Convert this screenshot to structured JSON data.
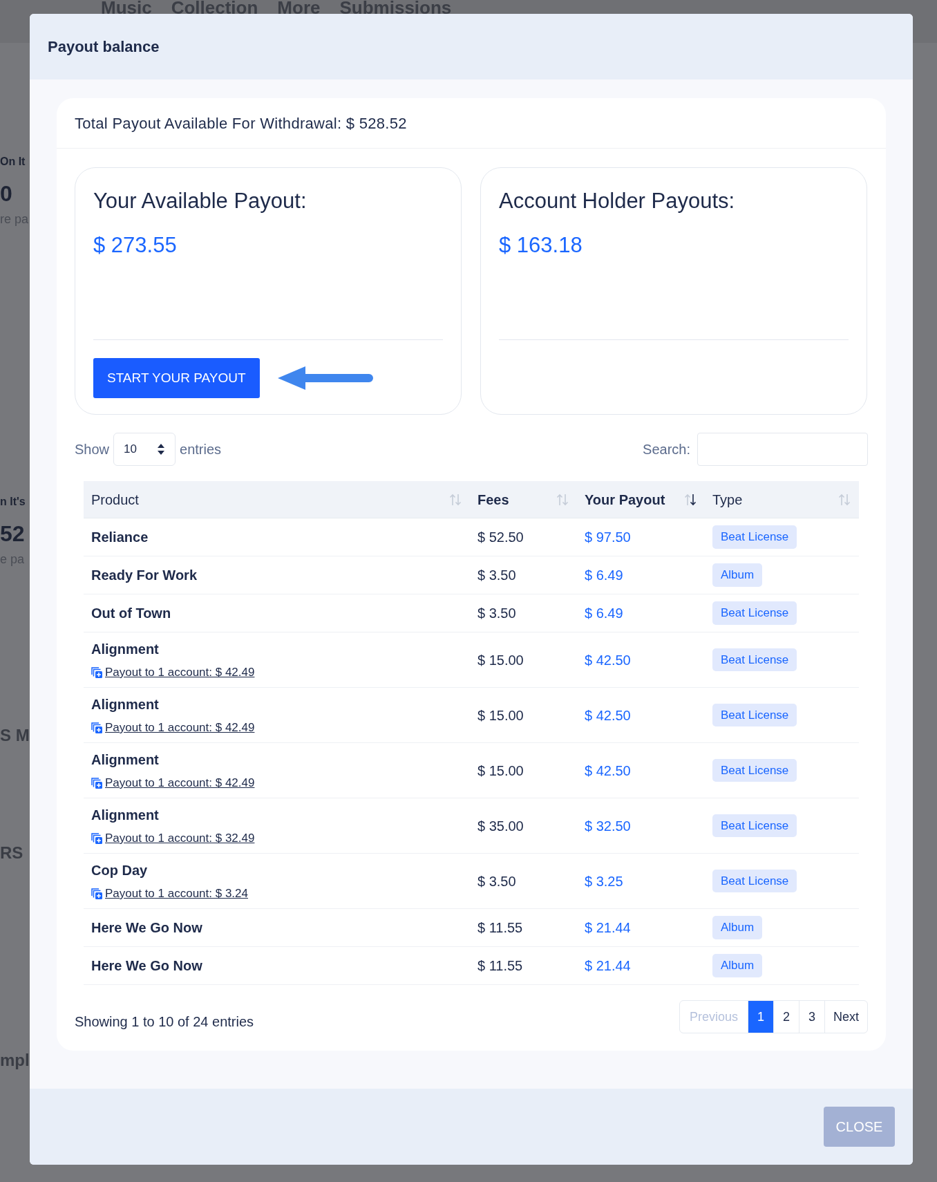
{
  "background": {
    "nav": [
      "Music",
      "Collection",
      "More",
      "Submissions"
    ],
    "fragments": [
      {
        "kind": "label",
        "text": "On It"
      },
      {
        "kind": "value",
        "text": "0"
      },
      {
        "kind": "note",
        "text": "re pa"
      },
      {
        "kind": "label",
        "text": "n It's"
      },
      {
        "kind": "value",
        "text": "52"
      },
      {
        "kind": "note",
        "text": "e pa"
      },
      {
        "kind": "heading",
        "text": "S M"
      },
      {
        "kind": "heading",
        "text": "RS"
      },
      {
        "kind": "heading",
        "text": "mpl"
      }
    ]
  },
  "modal": {
    "title": "Payout balance",
    "total": "Total Payout Available For Withdrawal: $ 528.52",
    "panels": [
      {
        "title": "Your Available Payout:",
        "amount": "$ 273.55",
        "button": "START YOUR PAYOUT"
      },
      {
        "title": "Account Holder Payouts:",
        "amount": "$ 163.18"
      }
    ],
    "length": {
      "before": "Show",
      "value": "10",
      "after": "entries"
    },
    "search": {
      "label": "Search:"
    },
    "table": {
      "columns": [
        {
          "label": "Product",
          "sorted_desc": false
        },
        {
          "label": "Fees",
          "sorted_desc": false
        },
        {
          "label": "Your Payout",
          "sorted_desc": true
        },
        {
          "label": "Type",
          "sorted_desc": false
        }
      ],
      "rows": [
        {
          "product": "Reliance",
          "fees": "$ 52.50",
          "payout": "$ 97.50",
          "type": "Beat License"
        },
        {
          "product": "Ready For Work",
          "fees": "$ 3.50",
          "payout": "$ 6.49",
          "type": "Album"
        },
        {
          "product": "Out of Town",
          "fees": "$ 3.50",
          "payout": "$ 6.49",
          "type": "Beat License"
        },
        {
          "product": "Alignment",
          "split": "Payout to 1 account: $ 42.49",
          "fees": "$ 15.00",
          "payout": "$ 42.50",
          "type": "Beat License"
        },
        {
          "product": "Alignment",
          "split": "Payout to 1 account: $ 42.49",
          "fees": "$ 15.00",
          "payout": "$ 42.50",
          "type": "Beat License"
        },
        {
          "product": "Alignment",
          "split": "Payout to 1 account: $ 42.49",
          "fees": "$ 15.00",
          "payout": "$ 42.50",
          "type": "Beat License"
        },
        {
          "product": "Alignment",
          "split": "Payout to 1 account: $ 32.49",
          "fees": "$ 35.00",
          "payout": "$ 32.50",
          "type": "Beat License"
        },
        {
          "product": "Cop Day",
          "split": "Payout to 1 account: $ 3.24",
          "fees": "$ 3.50",
          "payout": "$ 3.25",
          "type": "Beat License"
        },
        {
          "product": "Here We Go Now",
          "fees": "$ 11.55",
          "payout": "$ 21.44",
          "type": "Album"
        },
        {
          "product": "Here We Go Now",
          "fees": "$ 11.55",
          "payout": "$ 21.44",
          "type": "Album"
        }
      ]
    },
    "info": "Showing 1 to 10 of 24 entries",
    "pagination": {
      "previous": {
        "label": "Previous",
        "disabled": true
      },
      "pages": [
        {
          "label": "1",
          "selected": true
        },
        {
          "label": "2",
          "selected": false
        },
        {
          "label": "3",
          "selected": false
        }
      ],
      "next": {
        "label": "Next",
        "disabled": false
      }
    },
    "close": "CLOSE"
  }
}
